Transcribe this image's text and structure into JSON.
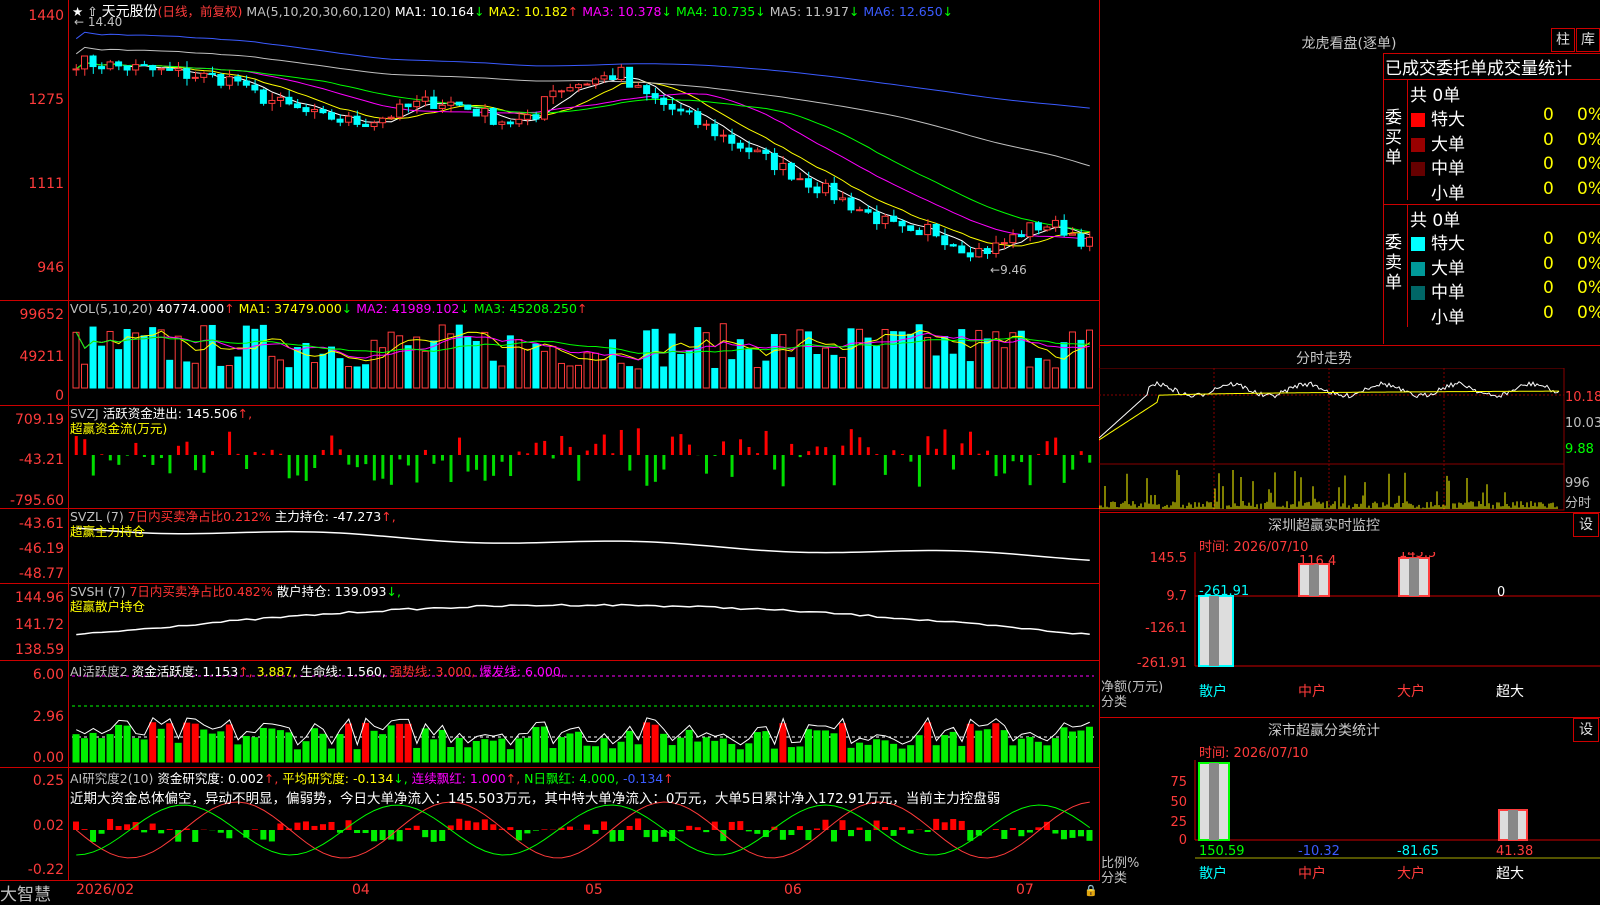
{
  "app": {
    "brand": "大智慧"
  },
  "main": {
    "stock_name": "天元股份",
    "period": "(日线，前复权)",
    "ma_header": "MA(5,10,20,30,60,120)",
    "ma": [
      {
        "label": "MA1:",
        "value": "10.164",
        "arrow": "↓",
        "color": "#ffffff"
      },
      {
        "label": "MA2:",
        "value": "10.182",
        "arrow": "↑",
        "color": "#ffff00"
      },
      {
        "label": "MA3:",
        "value": "10.378",
        "arrow": "↓",
        "color": "#ff00ff"
      },
      {
        "label": "MA4:",
        "value": "10.735",
        "arrow": "↓",
        "color": "#00ff00"
      },
      {
        "label": "MA5:",
        "value": "11.917",
        "arrow": "↓",
        "color": "#c0c0c0"
      },
      {
        "label": "MA6:",
        "value": "12.650",
        "arrow": "↓",
        "color": "#3b5bff"
      }
    ],
    "y_ticks": [
      "1440",
      "1275",
      "1111",
      "946"
    ],
    "high_label": "14.40",
    "low_label": "9.46",
    "x_ticks": [
      "2026/02",
      "04",
      "05",
      "06",
      "07"
    ]
  },
  "vol": {
    "header": "VOL(5,10,20)",
    "value": "40774.000",
    "value_arrow": "↑",
    "ma": [
      {
        "label": "MA1:",
        "value": "37479.000",
        "arrow": "↓",
        "color": "#ffff00"
      },
      {
        "label": "MA2:",
        "value": "41989.102",
        "arrow": "↓",
        "color": "#ff00ff"
      },
      {
        "label": "MA3:",
        "value": "45208.250",
        "arrow": "↑",
        "color": "#00ff00"
      }
    ],
    "y_ticks": [
      "99652",
      "49211",
      "0"
    ]
  },
  "svzj": {
    "name": "SVZJ",
    "label": "活跃资金进出:",
    "value": "145.506",
    "arrow": "↑,",
    "sub": "超赢资金流(万元)",
    "y_ticks": [
      "709.19",
      "-43.21",
      "-795.60"
    ]
  },
  "svzl": {
    "name": "SVZL (7)",
    "desc": "7日内买卖净占比0.212%",
    "label": "主力持仓:",
    "value": "-47.273",
    "arrow": "↑,",
    "sub": "超赢主力持仓",
    "y_ticks": [
      "-43.61",
      "-46.19",
      "-48.77"
    ]
  },
  "svsh": {
    "name": "SVSH (7)",
    "desc": "7日内买卖净占比0.482%",
    "label": "散户持仓:",
    "value": "139.093",
    "arrow": "↓,",
    "sub": "超赢散户持仓",
    "y_ticks": [
      "144.96",
      "141.72",
      "138.59"
    ]
  },
  "aihy": {
    "name": "AI活跃度2",
    "l1": "资金活跃度:",
    "v1": "1.153",
    "a1": "↑,",
    "v2": "3.887,",
    "l3": "生命线:",
    "v3": "1.560,",
    "l4": "强势线:",
    "v4": "3.000,",
    "l5": "爆发线:",
    "v5": "6.000,",
    "y_ticks": [
      "6.00",
      "2.96",
      "0.00"
    ]
  },
  "aiyj": {
    "name": "AI研究度2(10)",
    "l1": "资金研究度:",
    "v1": "0.002",
    "a1": "↑,",
    "l2": "平均研究度:",
    "v2": "-0.134",
    "a2": "↓,",
    "l3": "连续飘红:",
    "v3": "1.000",
    "a3": "↑,",
    "l4": "N日飘红:",
    "v4": "4.000,",
    "v5": "-0.134",
    "a5": "↑",
    "comment": "近期大资金总体偏空，异动不明显，偏弱势，今日大单净流入：145.503万元，其中特大单净流入：0万元，大单5日累计净入172.91万元，当前主力控盘弱",
    "y_ticks": [
      "0.25",
      "0.02",
      "-0.22"
    ]
  },
  "lhb": {
    "title": "龙虎看盘(逐单)",
    "btn1": "柱",
    "btn2": "库",
    "subtitle": "已成交委托单成交量统计",
    "buy": {
      "side": "委买单",
      "total": "共 0单",
      "rows": [
        {
          "name": "特大",
          "count": "0",
          "pct": "0%",
          "color": "#ff0000"
        },
        {
          "name": "大单",
          "count": "0",
          "pct": "0%",
          "color": "#990000"
        },
        {
          "name": "中单",
          "count": "0",
          "pct": "0%",
          "color": "#660000"
        },
        {
          "name": "小单",
          "count": "0",
          "pct": "0%",
          "color": "#000000"
        }
      ]
    },
    "sell": {
      "side": "委卖单",
      "total": "共 0单",
      "rows": [
        {
          "name": "特大",
          "count": "0",
          "pct": "0%",
          "color": "#00ffff"
        },
        {
          "name": "大单",
          "count": "0",
          "pct": "0%",
          "color": "#009999"
        },
        {
          "name": "中单",
          "count": "0",
          "pct": "0%",
          "color": "#006666"
        },
        {
          "name": "小单",
          "count": "0",
          "pct": "0%",
          "color": "#000000"
        }
      ]
    }
  },
  "fenshi": {
    "title": "分时走势",
    "y_ticks": [
      "10.18",
      "10.03",
      "9.88"
    ],
    "vol_tick": "996",
    "vol_unit": "分时"
  },
  "monitor": {
    "title": "深圳超赢实时监控",
    "btn": "设",
    "time": "时间: 2026/07/10",
    "y_ticks": [
      "145.5",
      "9.7",
      "-126.1",
      "-261.91"
    ],
    "bar_labels": [
      "-261.91",
      "116.4",
      "145.5",
      "0"
    ],
    "categories": [
      "散户",
      "中户",
      "大户",
      "超大"
    ],
    "cat_colors": [
      "#00ffff",
      "#ff3b3b",
      "#ff3b3b",
      "#ffffff"
    ],
    "axis_title1": "净额(万元)",
    "axis_title2": "分类"
  },
  "classify": {
    "title": "深市超赢分类统计",
    "btn": "设",
    "time": "时间: 2026/07/10",
    "y_ticks": [
      "75",
      "50",
      "25",
      "0"
    ],
    "values": [
      "150.59",
      "-10.32",
      "-81.65",
      "41.38"
    ],
    "value_colors": [
      "#00ff00",
      "#3b5bff",
      "#00ffff",
      "#ff3b3b"
    ],
    "categories": [
      "散户",
      "中户",
      "大户",
      "超大"
    ],
    "cat_colors": [
      "#00ffff",
      "#ff3b3b",
      "#ff3b3b",
      "#ffffff"
    ],
    "axis_title1": "比例%",
    "axis_title2": "分类"
  }
}
